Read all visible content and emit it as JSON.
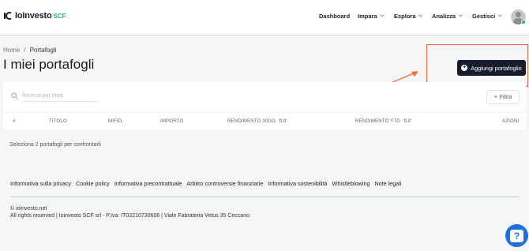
{
  "brand": {
    "name": "IoInvesto",
    "suffix": "SCF"
  },
  "nav": {
    "dashboard": "Dashboard",
    "impara": "Impara",
    "esplora": "Esplora",
    "analizza": "Analizza",
    "gestisci": "Gestisci"
  },
  "breadcrumb": {
    "home": "Home",
    "separator": "/",
    "current": "Portafogli"
  },
  "page": {
    "title": "I miei portafogli",
    "add_button": "Aggiungi portafoglio"
  },
  "search": {
    "placeholder": "Ricerca per titolo",
    "value": ""
  },
  "filter": {
    "label": "Filtra"
  },
  "table": {
    "columns": {
      "index": "#",
      "titolo": "TITOLO",
      "mifid": "MIFID",
      "importo": "IMPORTO",
      "rend30": "RENDIMENTO 30GG",
      "rendytd": "RENDIMENTO YTD",
      "azioni": "AZIONI"
    },
    "rows": []
  },
  "hint": "Seleziona 2 portafogli per confrontarli",
  "footer": {
    "links": [
      "Informativa sulla privacy",
      "Cookie policy",
      "Informativa precontrattuale",
      "Arbitro controversie finanziarie",
      "Informativa sostenibilità",
      "Whistleblowing",
      "Note legali"
    ],
    "copyright": "© ioinvesto.net",
    "legal": "All rights reserved | Ioinvesto SCF srl - P.Iva: IT03210730606 | Viale Fabrateria Vetus 35 Ceccano"
  },
  "colors": {
    "accent_green": "#19b38a",
    "button_dark": "#171c2c",
    "highlight_orange": "#f06a3b",
    "help_blue": "#1e6fe0"
  },
  "icons": [
    "logo-icon",
    "chevron-down-icon",
    "avatar",
    "plus-circle-icon",
    "search-icon",
    "filter-icon",
    "sort-icon",
    "help-icon",
    "arrow-annotation"
  ]
}
